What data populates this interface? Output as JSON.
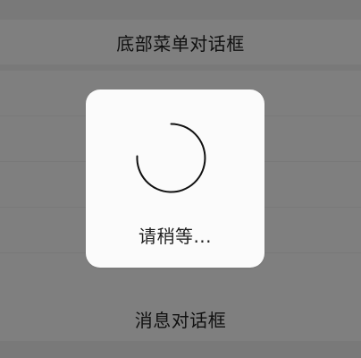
{
  "list": {
    "buttons": [
      {
        "label": "底部菜单对话框"
      },
      {
        "label": ""
      },
      {
        "label": ""
      },
      {
        "label": ""
      },
      {
        "label": ""
      },
      {
        "label": ""
      },
      {
        "label": "消息对话框"
      }
    ]
  },
  "loading_toast": {
    "message": "请稍等...",
    "icon": "spinner-icon"
  },
  "colors": {
    "overlay": "rgba(0,0,0,0.5)",
    "toast_bg": "#fbfbfb",
    "text": "#222222"
  }
}
